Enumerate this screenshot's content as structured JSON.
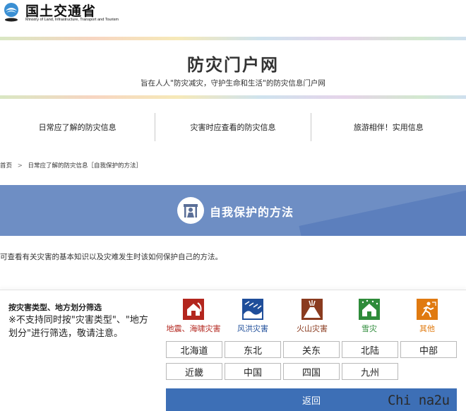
{
  "header": {
    "org_name": "国土交通省",
    "org_name_en": "Ministry of Land, Infrastructure, Transport and Tourism"
  },
  "portal": {
    "title": "防灾门户网",
    "subtitle": "旨在人人\"防灾减灾，守护生命和生活\"的防灾信息门户网"
  },
  "nav": {
    "items": [
      {
        "label": "日常应了解的防灾信息"
      },
      {
        "label": "灾害时应查看的防灾信息"
      },
      {
        "label": "旅游相伴！实用信息"
      }
    ]
  },
  "breadcrumb": {
    "home": "首页",
    "separator": ">",
    "current": "日常应了解的防灾信息［自我保护的方法］"
  },
  "banner": {
    "title": "自我保护的方法",
    "icon": "self-protection-icon"
  },
  "description": "可查看有关灾害的基本知识以及灾难发生时该如何保护自己的方法。",
  "filter": {
    "title": "按灾害类型、地方划分筛选",
    "note": "※不支持同时按\"灾害类型\"、\"地方划分\"进行筛选，敬请注意。",
    "categories": [
      {
        "label": "地震、海啸灾害",
        "icon": "earthquake-house-icon",
        "color": "#b3261e"
      },
      {
        "label": "风洪灾害",
        "icon": "storm-wave-icon",
        "color": "#1f4e9a"
      },
      {
        "label": "火山灾害",
        "icon": "volcano-icon",
        "color": "#8a3b1f"
      },
      {
        "label": "雪灾",
        "icon": "snow-house-icon",
        "color": "#2e8b3a"
      },
      {
        "label": "其他",
        "icon": "running-person-icon",
        "color": "#e07a10"
      }
    ],
    "regions": [
      {
        "label": "北海道"
      },
      {
        "label": "东北"
      },
      {
        "label": "关东"
      },
      {
        "label": "北陆"
      },
      {
        "label": "中部"
      },
      {
        "label": "近畿"
      },
      {
        "label": "中国"
      },
      {
        "label": "四国"
      },
      {
        "label": "九州"
      }
    ],
    "back_label": "返回"
  },
  "watermark": "Chi na2u"
}
